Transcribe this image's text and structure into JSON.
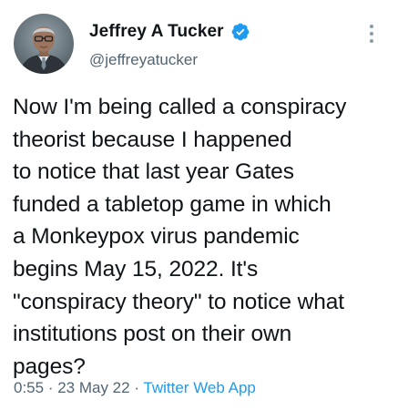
{
  "author": {
    "display_name": "Jeffrey A Tucker",
    "handle": "@jeffreyatucker",
    "verified": true
  },
  "tweet": {
    "lines": [
      "Now I'm being called a conspiracy",
      "theorist because I happened",
      "to notice that last year Gates",
      "funded a tabletop game in which",
      "a Monkeypox virus pandemic",
      "begins May 15, 2022. It's",
      "\"conspiracy theory\" to notice what",
      "institutions post on their own",
      "pages?"
    ]
  },
  "meta": {
    "time": "0:55",
    "separator": " · ",
    "date": "23 May 22",
    "source": "Twitter Web App"
  },
  "colors": {
    "verified_badge": "#1d9bf0",
    "secondary_text": "#536471",
    "link": "#1d9bf0"
  },
  "icons": {
    "verified": "verified-badge-icon",
    "more": "more-options-icon"
  }
}
